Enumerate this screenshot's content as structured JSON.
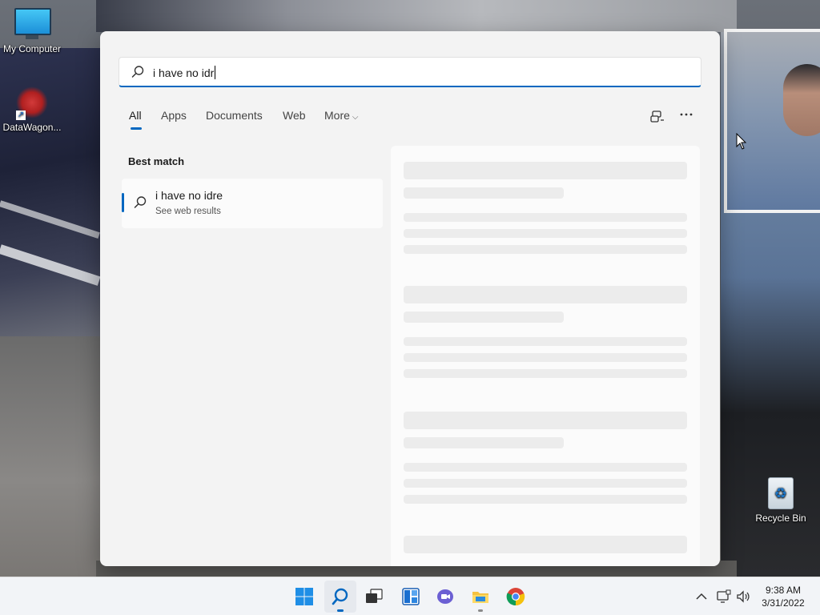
{
  "desktop": {
    "icons": [
      {
        "label": "My Computer"
      },
      {
        "label": "DataWagon..."
      },
      {
        "label": "Recycle Bin"
      }
    ]
  },
  "search": {
    "query": "i have no idr",
    "tabs": [
      "All",
      "Apps",
      "Documents",
      "Web",
      "More"
    ],
    "active_tab": "All",
    "best_match_label": "Best match",
    "result": {
      "title": "i have no idre",
      "subtitle": "See web results"
    }
  },
  "taskbar": {
    "apps": [
      "start-icon",
      "search-icon",
      "task-view-icon",
      "widgets-icon",
      "teams-chat-icon",
      "file-explorer-icon",
      "chrome-icon"
    ],
    "time": "9:38 AM",
    "date": "3/31/2022"
  },
  "colors": {
    "accent": "#0067c0",
    "panel_bg": "#f3f3f3",
    "taskbar_bg": "#f2f4f7"
  }
}
